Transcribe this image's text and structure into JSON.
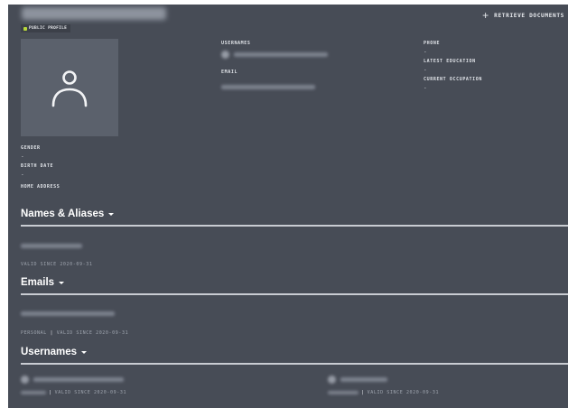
{
  "header": {
    "badge_label": "PUBLIC PROFILE",
    "retrieve_label": "RETRIEVE DOCUMENTS",
    "retrieve_icon": "plus-icon"
  },
  "profile": {
    "avatar_icon": "user-icon",
    "usernames_label": "USERNAMES",
    "email_label": "EMAIL",
    "phone_label": "PHONE",
    "phone_value": "-",
    "latest_education_label": "LATEST EDUCATION",
    "latest_education_value": "-",
    "current_occupation_label": "CURRENT OCCUPATION",
    "current_occupation_value": "-",
    "gender_label": "GENDER",
    "gender_value": "-",
    "birth_date_label": "BIRTH DATE",
    "birth_date_value": "-",
    "home_address_label": "HOME ADDRESS"
  },
  "sections": {
    "names": {
      "title": "Names & Aliases",
      "meta": "VALID SINCE 2020-09-31"
    },
    "emails": {
      "title": "Emails",
      "type": "PERSONAL",
      "separator": "|",
      "meta": "VALID SINCE 2020-09-31"
    },
    "usernames": {
      "title": "Usernames",
      "items": [
        {
          "separator": "|",
          "meta": "VALID SINCE 2020-09-31"
        },
        {
          "separator": "|",
          "meta": "VALID SINCE 2020-09-31"
        }
      ]
    }
  },
  "colors": {
    "panel_bg": "#474c56",
    "avatar_bg": "#5b616c",
    "badge_accent": "#b8d83a",
    "rule": "#c9ccd2"
  }
}
